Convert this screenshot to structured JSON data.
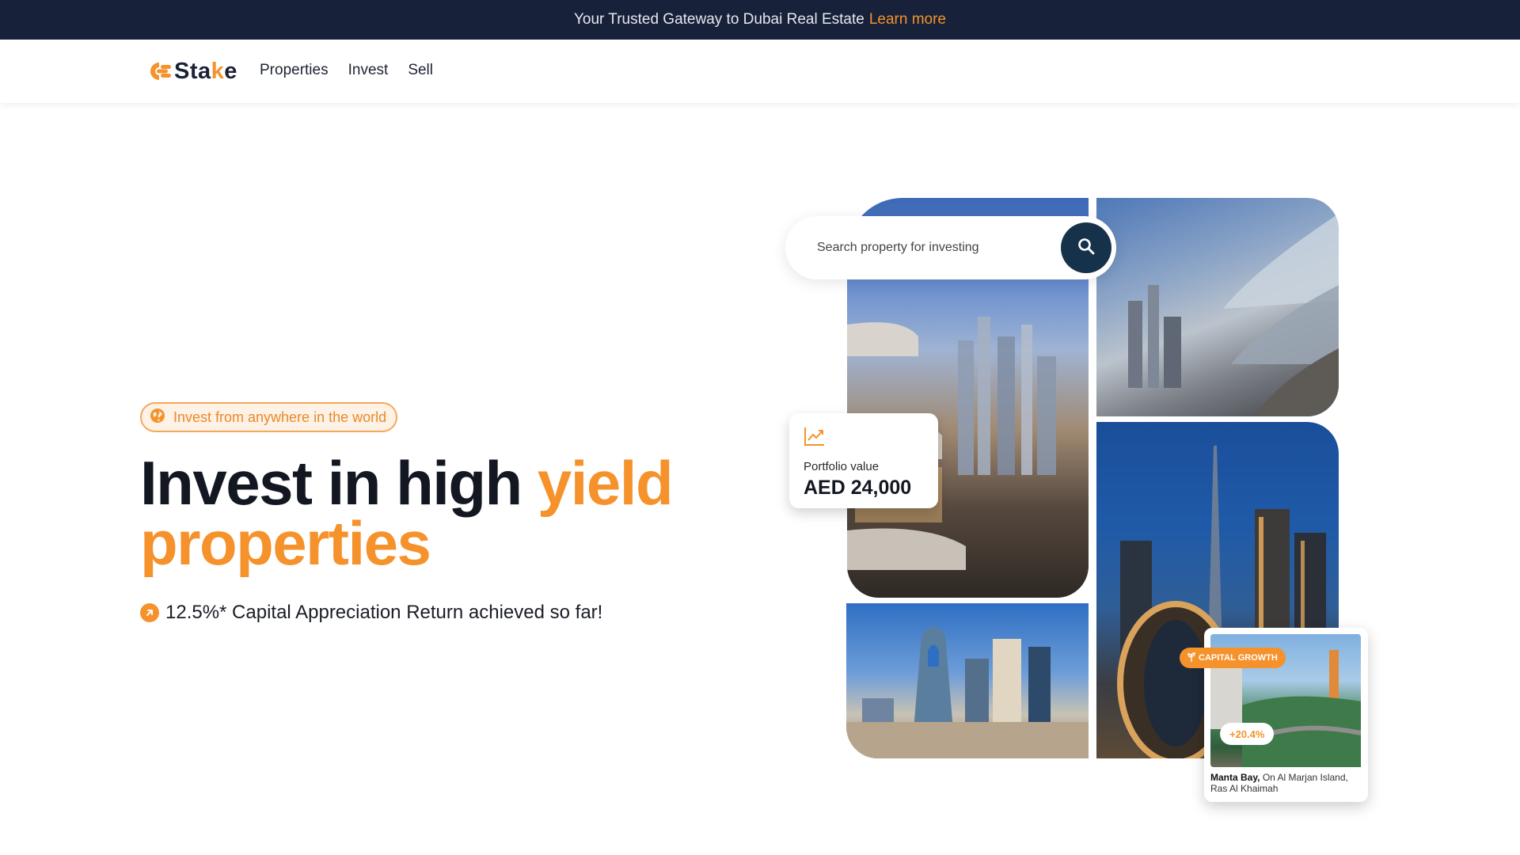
{
  "announcement": {
    "text": "Your Trusted Gateway to Dubai Real Estate",
    "link": "Learn more"
  },
  "brand": {
    "name_prefix": "Sta",
    "name_accent": "k",
    "name_suffix": "e",
    "accent_color": "#f5922b",
    "dark_color": "#17213a"
  },
  "nav": {
    "items": [
      "Properties",
      "Invest",
      "Sell"
    ]
  },
  "hero": {
    "pill_icon": "globe-icon",
    "pill_text": "Invest from anywhere in the world",
    "headline_part1": "Invest in high",
    "headline_accent1": "yield",
    "headline_accent2": "properties",
    "stat_icon": "arrow-up-right-icon",
    "stat_text": "12.5%* Capital Appreciation Return achieved so far!"
  },
  "search": {
    "placeholder": "Search property for investing",
    "icon": "search-icon"
  },
  "portfolio": {
    "icon": "trending-up-icon",
    "label": "Portfolio value",
    "value": "AED 24,000"
  },
  "property_card": {
    "badge": "CAPITAL GROWTH",
    "badge_icon": "sprout-icon",
    "change": "+20.4%",
    "name": "Manta Bay,",
    "location": "On Al Marjan Island, Ras Al Khaimah"
  }
}
